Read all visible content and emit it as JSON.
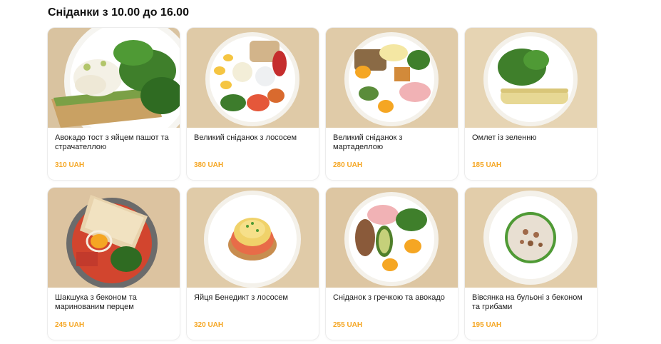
{
  "section": {
    "title": "Сніданки з 10.00 до 16.00"
  },
  "colors": {
    "price": "#f5a623",
    "photo_bg": "#dcc7a5"
  },
  "menu": {
    "items": [
      {
        "name": "Авокадо тост з яйцем пашот та страчателлою",
        "price": "310 UAH"
      },
      {
        "name": "Великий сніданок з лососем",
        "price": "380 UAH"
      },
      {
        "name": "Великий сніданок з мартаделлою",
        "price": "280 UAH"
      },
      {
        "name": "Омлет із зеленню",
        "price": "185 UAH"
      },
      {
        "name": "Шакшука з беконом та маринованим перцем",
        "price": "245 UAH"
      },
      {
        "name": "Яйця Бенедикт з лососем",
        "price": "320 UAH"
      },
      {
        "name": "Сніданок з гречкою та авокадо",
        "price": "255 UAH"
      },
      {
        "name": "Вівсянка на бульоні з беконом та грибами",
        "price": "195 UAH"
      }
    ]
  }
}
